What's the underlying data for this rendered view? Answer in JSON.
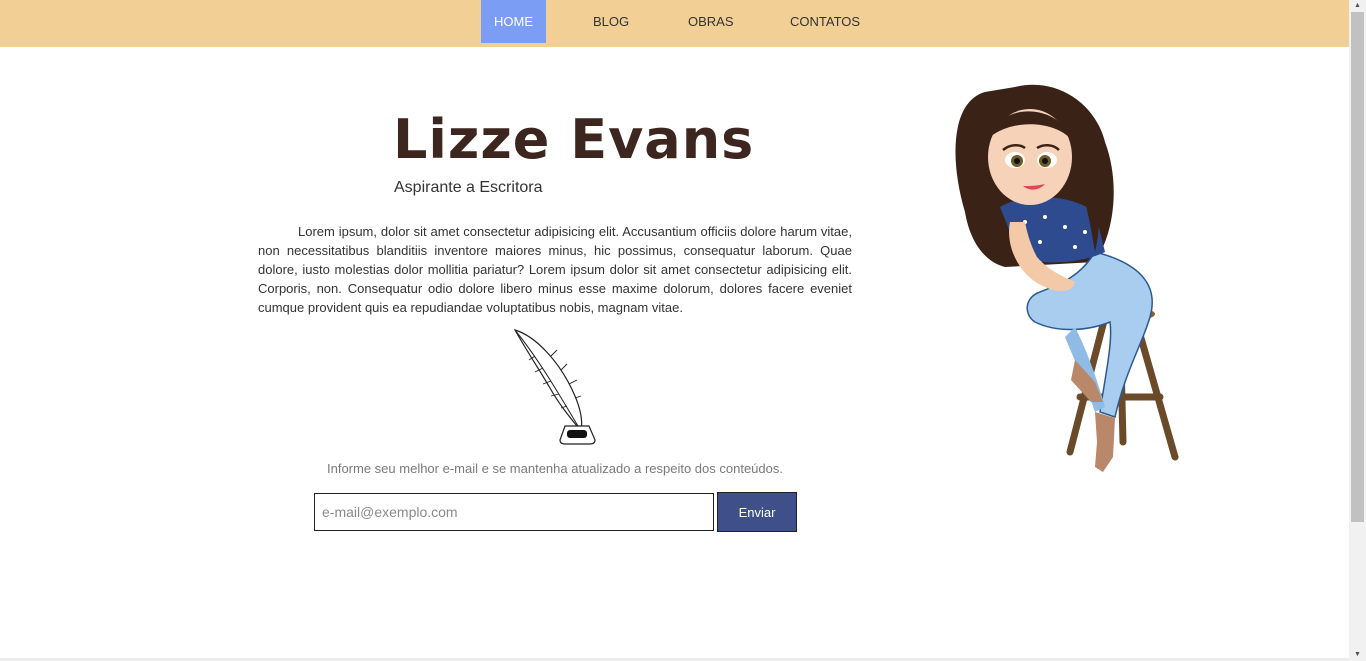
{
  "nav": {
    "items": [
      {
        "label": "HOME",
        "active": true
      },
      {
        "label": "BLOG",
        "active": false
      },
      {
        "label": "OBRAS",
        "active": false
      },
      {
        "label": "CONTATOS",
        "active": false
      }
    ]
  },
  "hero": {
    "title": "Lizze Evans",
    "subtitle": "Aspirante a Escritora",
    "body": "Lorem ipsum, dolor sit amet consectetur adipisicing elit. Accusantium officiis dolore harum vitae, non necessitatibus blanditiis inventore maiores minus, hic possimus, consequatur laborum. Quae dolore, iusto molestias dolor mollitia pariatur? Lorem ipsum dolor sit amet consectetur adipisicing elit. Corporis, non. Consequatur odio dolore libero minus esse maxime dolorum, dolores facere eveniet cumque provident quis ea repudiandae voluptatibus nobis, magnam vitae."
  },
  "newsletter": {
    "text": "Informe seu melhor e-mail e se mantenha atualizado a respeito dos conteúdos.",
    "email_placeholder": "e-mail@exemplo.com",
    "email_value": "",
    "send_label": "Enviar"
  },
  "colors": {
    "navbar_bg": "#f2d095",
    "nav_active_bg": "#7b9df3",
    "title_color": "#3d2520",
    "button_bg": "#3f4f8a"
  },
  "icons": {
    "quill": "quill-inkwell-icon",
    "avatar": "avatar-illustration"
  }
}
